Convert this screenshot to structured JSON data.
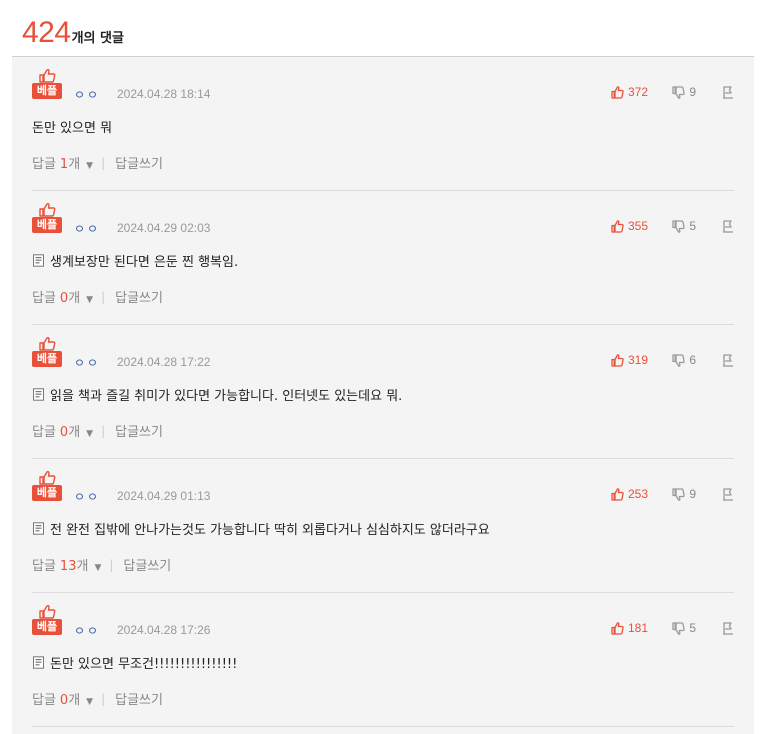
{
  "header": {
    "count": "424",
    "count_suffix": "개의 댓글"
  },
  "labels": {
    "best": "베플",
    "reply": "답글",
    "reply_unit": "개",
    "write_reply": "답글쓰기",
    "separator": "|",
    "caret": "▼"
  },
  "colors": {
    "accent": "#e8503a",
    "muted": "#888888",
    "panel": "#f4f4f4"
  },
  "comments": [
    {
      "nickname": "ㅇㅇ",
      "date": "2024.04.28 18:14",
      "likes": "372",
      "dislikes": "9",
      "text": "돈만 있으면 뭐",
      "has_doc_icon": false,
      "reply_count": "1"
    },
    {
      "nickname": "ㅇㅇ",
      "date": "2024.04.29 02:03",
      "likes": "355",
      "dislikes": "5",
      "text": "생계보장만 된다면 은둔 찐 행복임.",
      "has_doc_icon": true,
      "reply_count": "0"
    },
    {
      "nickname": "ㅇㅇ",
      "date": "2024.04.28 17:22",
      "likes": "319",
      "dislikes": "6",
      "text": "읽을 책과 즐길 취미가 있다면 가능합니다. 인터넷도 있는데요 뭐.",
      "has_doc_icon": true,
      "reply_count": "0"
    },
    {
      "nickname": "ㅇㅇ",
      "date": "2024.04.29 01:13",
      "likes": "253",
      "dislikes": "9",
      "text": "전 완전 집밖에 안나가는것도 가능합니다 딱히 외롭다거나 심심하지도 않더라구요",
      "has_doc_icon": true,
      "reply_count": "13"
    },
    {
      "nickname": "ㅇㅇ",
      "date": "2024.04.28 17:26",
      "likes": "181",
      "dislikes": "5",
      "text": "돈만 있으면 무조건!!!!!!!!!!!!!!!!",
      "has_doc_icon": true,
      "reply_count": "0"
    }
  ]
}
